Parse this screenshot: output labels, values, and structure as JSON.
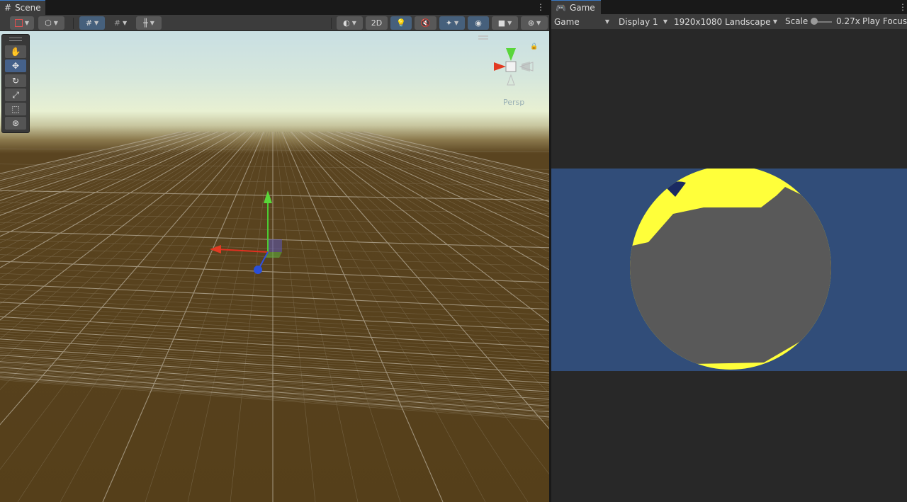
{
  "scene": {
    "tab_label": "Scene",
    "toolbar": {
      "toggle_2d_label": "2D"
    },
    "view_mode_label": "Persp"
  },
  "game": {
    "tab_label": "Game",
    "mode_label": "Game",
    "display_label": "Display 1",
    "resolution_label": "1920x1080 Landscape",
    "scale_label": "Scale",
    "scale_value": "0.27x",
    "play_focus_label": "Play Focus"
  },
  "colors": {
    "game_background": "#314d79",
    "sphere_gray": "#595959",
    "sphere_yellow": "#ffff3a",
    "ground_brown": "#553f1a",
    "active_tool": "#45618a"
  },
  "icons": {
    "tools": [
      "hand-icon",
      "move-icon",
      "rotate-icon",
      "scale-icon",
      "rect-icon",
      "transform-icon"
    ]
  }
}
